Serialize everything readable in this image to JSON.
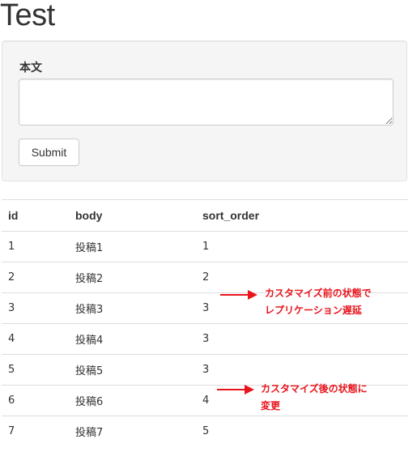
{
  "page": {
    "title": "Test"
  },
  "form": {
    "body_label": "本文",
    "body_value": "",
    "submit_label": "Submit"
  },
  "table": {
    "headers": [
      "id",
      "body",
      "sort_order"
    ],
    "rows": [
      [
        "1",
        "投稿1",
        "1"
      ],
      [
        "2",
        "投稿2",
        "2"
      ],
      [
        "3",
        "投稿3",
        "3"
      ],
      [
        "4",
        "投稿4",
        "3"
      ],
      [
        "5",
        "投稿5",
        "3"
      ],
      [
        "6",
        "投稿6",
        "4"
      ],
      [
        "7",
        "投稿7",
        "5"
      ]
    ]
  },
  "annotations": [
    {
      "line1": "カスタマイズ前の状態で",
      "line2": "レプリケーション遅延",
      "color": "#e8141c"
    },
    {
      "line1": "カスタマイズ後の状態に",
      "line2": "変更",
      "color": "#e8141c"
    }
  ]
}
